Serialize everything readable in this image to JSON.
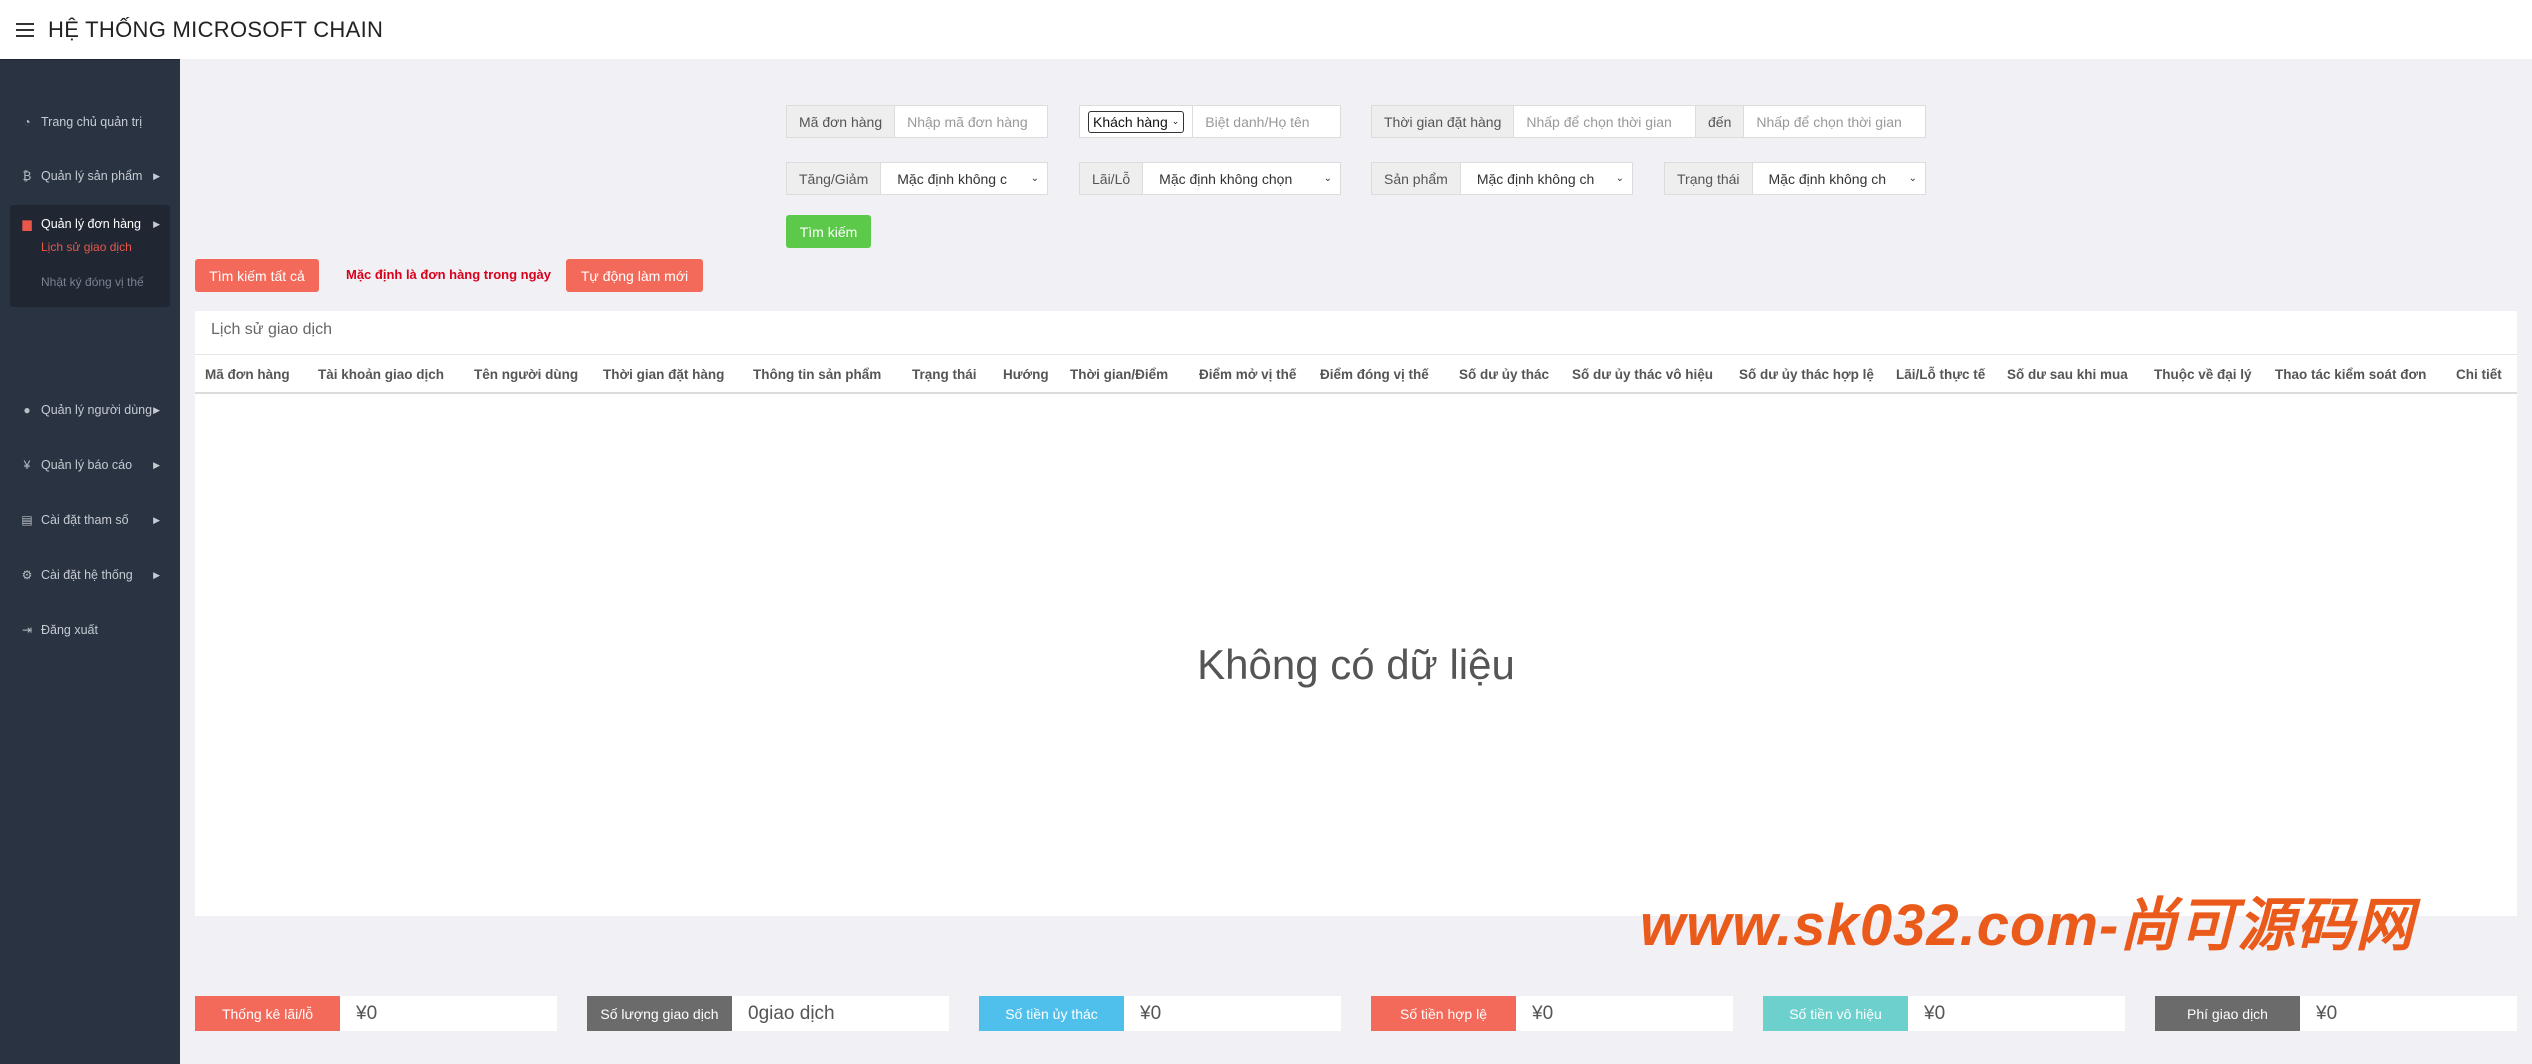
{
  "app": {
    "title": "HỆ THỐNG MICROSOFT CHAIN"
  },
  "sidebar": {
    "items": [
      {
        "label": "Trang chủ quản trị",
        "icon": "dashboard-icon"
      },
      {
        "label": "Quản lý sản phẩm",
        "icon": "bitcoin-icon"
      },
      {
        "label": "Quản lý đơn hàng",
        "icon": "document-icon"
      },
      {
        "label": "Quản lý người dùng",
        "icon": "user-icon"
      },
      {
        "label": "Quản lý báo cáo",
        "icon": "yen-icon"
      },
      {
        "label": "Cài đặt tham số",
        "icon": "file-icon"
      },
      {
        "label": "Cài đặt hệ thống",
        "icon": "cogs-icon"
      },
      {
        "label": "Đăng xuất",
        "icon": "logout-icon"
      }
    ],
    "subitems": [
      {
        "label": "Lịch sử giao dịch"
      },
      {
        "label": "Nhật ký đóng vị thế"
      }
    ]
  },
  "filters": {
    "order_id": {
      "label": "Mã đơn hàng",
      "placeholder": "Nhập mã đơn hàng"
    },
    "customer": {
      "select_value": "Khách hàng",
      "placeholder": "Biệt danh/Họ tên"
    },
    "order_time": {
      "label": "Thời gian đặt hàng",
      "from_placeholder": "Nhấp để chọn thời gian",
      "to_label": "đến",
      "to_placeholder": "Nhấp để chọn thời gian"
    },
    "direction": {
      "label": "Tăng/Giảm",
      "value": "Mặc định không c"
    },
    "profit_loss": {
      "label": "Lãi/Lỗ",
      "value": "Mặc định không chọn"
    },
    "product": {
      "label": "Sản phẩm",
      "value": "Mặc định không ch"
    },
    "status": {
      "label": "Trạng thái",
      "value": "Mặc định không ch"
    },
    "search_button": "Tìm kiếm"
  },
  "actions": {
    "search_all": "Tìm kiếm tất cả",
    "default_note": "Mặc định là đơn hàng trong ngày",
    "auto_refresh": "Tự động làm mới"
  },
  "table": {
    "title": "Lịch sử giao dịch",
    "columns": [
      "Mã đơn hàng",
      "Tài khoản giao dịch",
      "Tên người dùng",
      "Thời gian đặt hàng",
      "Thông tin sản phẩm",
      "Trạng thái",
      "Hướng",
      "Thời gian/Điểm",
      "Điểm mở vị thế",
      "Điểm đóng vị thế",
      "Số dư ủy thác",
      "Số dư ủy thác vô hiệu",
      "Số dư ủy thác hợp lệ",
      "Lãi/Lỗ thực tế",
      "Số dư sau khi mua",
      "Thuộc về đại lý",
      "Thao tác kiểm soát đơn",
      "Chi tiết"
    ],
    "empty_text": "Không có dữ liệu"
  },
  "stats": [
    {
      "label": "Thống kê lãi/lỗ",
      "value": "¥0",
      "color": "#f36a5a"
    },
    {
      "label": "Số lượng giao dịch",
      "value": "0giao dịch",
      "color": "#6b6b6b"
    },
    {
      "label": "Số tiền ủy thác",
      "value": "¥0",
      "color": "#4fc0ec"
    },
    {
      "label": "Số tiền hợp lệ",
      "value": "¥0",
      "color": "#f36a5a"
    },
    {
      "label": "Số tiền vô hiệu",
      "value": "¥0",
      "color": "#6cd0cc"
    },
    {
      "label": "Phí giao dịch",
      "value": "¥0",
      "color": "#6b6b6b"
    }
  ],
  "watermark": "www.sk032.com-尚可源码网"
}
